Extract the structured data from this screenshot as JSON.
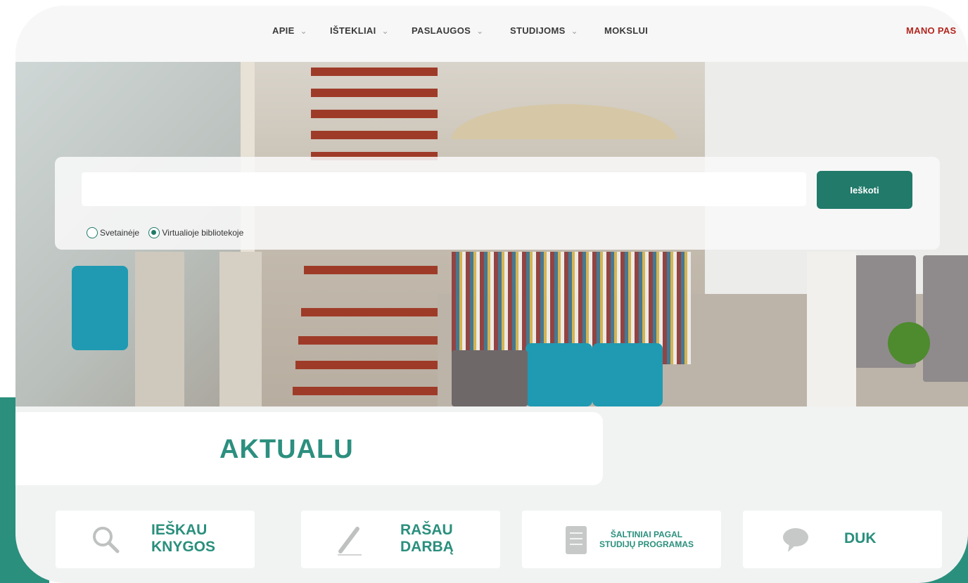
{
  "nav": {
    "items": [
      {
        "label": "APIE",
        "has_dropdown": true
      },
      {
        "label": "IŠTEKLIAI",
        "has_dropdown": true
      },
      {
        "label": "PASLAUGOS",
        "has_dropdown": true
      },
      {
        "label": "STUDIJOMS",
        "has_dropdown": true
      },
      {
        "label": "MOKSLUI",
        "has_dropdown": false
      }
    ],
    "account_label": "MANO PAS",
    "chevron": "⌄"
  },
  "search": {
    "input_value": "",
    "placeholder": "",
    "button_label": "Ieškoti",
    "scope_options": [
      {
        "label": "Svetainėje",
        "checked": false
      },
      {
        "label": "Virtualioje bibliotekoje",
        "checked": true
      }
    ]
  },
  "section": {
    "title": "AKTUALU"
  },
  "tiles": [
    {
      "icon": "search-icon",
      "label_line1": "IEŠKAU",
      "label_line2": "KNYGOS"
    },
    {
      "icon": "pen-icon",
      "label_line1": "RAŠAU",
      "label_line2": "DARBĄ"
    },
    {
      "icon": "document-icon",
      "label_line1": "ŠALTINIAI PAGAL",
      "label_line2": "STUDIJŲ PROGRAMAS"
    },
    {
      "icon": "chat-bubble-icon",
      "label_line1": "DUK",
      "label_line2": ""
    }
  ],
  "colors": {
    "accent": "#217a6a",
    "accent_light": "#2a8f7d",
    "account_red": "#b3261e"
  }
}
